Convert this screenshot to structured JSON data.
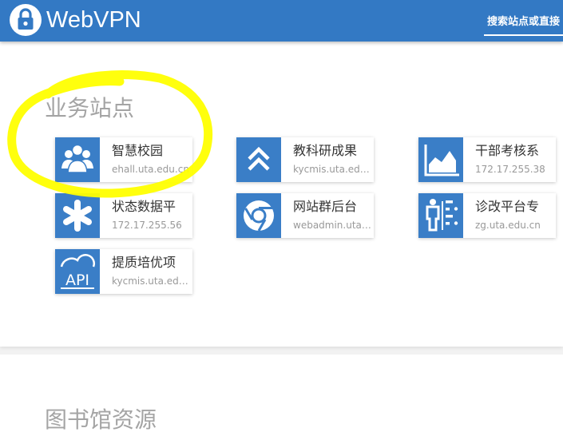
{
  "header": {
    "brand": "WebVPN",
    "search_placeholder": "搜索站点或直接"
  },
  "sections": [
    {
      "title": "业务站点"
    },
    {
      "title": "图书馆资源"
    }
  ],
  "sites": [
    {
      "name": "智慧校园",
      "address": "ehall.uta.edu.cn",
      "icon": "people-icon"
    },
    {
      "name": "教科研成果",
      "address": "kycmis.uta.edu.cn",
      "icon": "chevron-up-icon"
    },
    {
      "name": "干部考核系",
      "address": "172.17.255.38",
      "icon": "area-chart-icon"
    },
    {
      "name": "状态数据平",
      "address": "172.17.255.56",
      "icon": "asterisk-icon"
    },
    {
      "name": "网站群后台",
      "address": "webadmin.uta.edu.cn",
      "icon": "chrome-icon"
    },
    {
      "name": "诊改平台专",
      "address": "zg.uta.edu.cn",
      "icon": "person-chart-icon"
    },
    {
      "name": "提质培优项",
      "address": "kycmis.uta.edu.cn",
      "icon": "api-icon"
    }
  ],
  "colors": {
    "header": "#3379c4",
    "tile": "#3a7ec7",
    "highlight": "#ffff00"
  }
}
